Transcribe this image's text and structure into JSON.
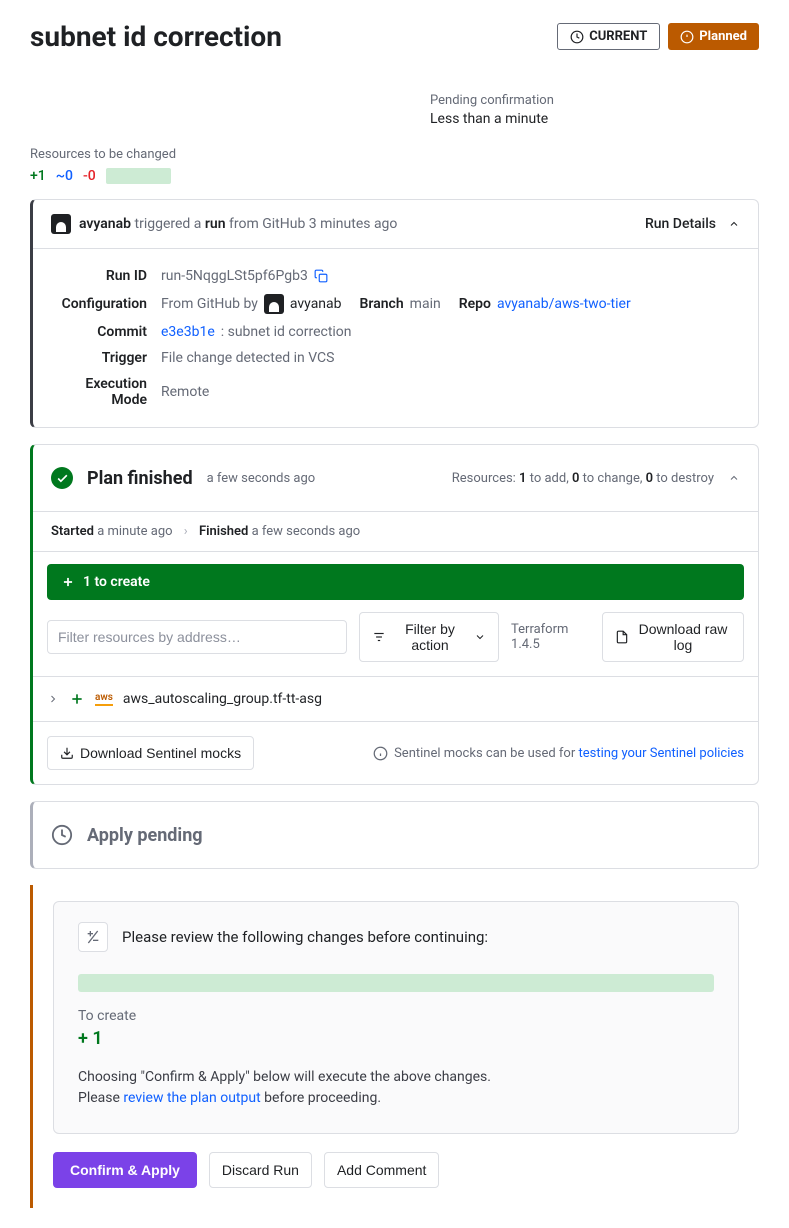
{
  "header": {
    "title": "subnet id correction",
    "current_badge": "CURRENT",
    "planned_badge": "Planned"
  },
  "pending": {
    "label": "Pending confirmation",
    "time": "Less than a minute"
  },
  "resources_summary": {
    "label": "Resources to be changed",
    "add": "+1",
    "change": "~0",
    "destroy": "-0"
  },
  "run_details": {
    "trigger_user": "avyanab",
    "trigger_text_1": " triggered a ",
    "trigger_run": "run",
    "trigger_text_2": " from GitHub 3 minutes ago",
    "run_details_label": "Run Details",
    "run_id_label": "Run ID",
    "run_id_value": "run-5NqggLSt5pf6Pgb3",
    "config_label": "Configuration",
    "config_from": "From GitHub  by",
    "config_user": "avyanab",
    "branch_label": "Branch",
    "branch_value": "main",
    "repo_label": "Repo",
    "repo_value": "avyanab/aws-two-tier",
    "commit_label": "Commit",
    "commit_hash": "e3e3b1e",
    "commit_message": ": subnet id correction",
    "vcs_trigger_label": "Trigger",
    "vcs_trigger_value": "File change detected in VCS",
    "exec_mode_label": "Execution Mode",
    "exec_mode_value": "Remote"
  },
  "plan": {
    "title": "Plan finished",
    "time": "a few seconds ago",
    "resources_prefix": "Resources: ",
    "to_add": "1",
    "to_add_suffix": " to add, ",
    "to_change": "0",
    "to_change_suffix": " to change, ",
    "to_destroy": "0",
    "to_destroy_suffix": " to destroy",
    "started_label": "Started",
    "started_time": " a minute ago",
    "finished_label": "Finished",
    "finished_time": " a few seconds ago",
    "create_bar": "1 to create",
    "filter_placeholder": "Filter resources by address…",
    "filter_action_label": "Filter by action",
    "tf_version": "Terraform 1.4.5",
    "download_log": "Download raw log",
    "resource_provider": "aws",
    "resource_name": "aws_autoscaling_group.tf-tt-asg",
    "download_mocks": "Download Sentinel mocks",
    "sentinel_info_prefix": "Sentinel mocks can be used for ",
    "sentinel_info_link": "testing your Sentinel policies"
  },
  "apply": {
    "title": "Apply pending"
  },
  "confirm": {
    "review_title": "Please review the following changes before continuing:",
    "to_create_label": "To create",
    "to_create_count": "+ 1",
    "line1": "Choosing \"Confirm & Apply\" below will execute the above changes.",
    "line2_prefix": "Please ",
    "line2_link": "review the plan output",
    "line2_suffix": " before proceeding.",
    "confirm_btn": "Confirm & Apply",
    "discard_btn": "Discard Run",
    "comment_btn": "Add Comment"
  }
}
